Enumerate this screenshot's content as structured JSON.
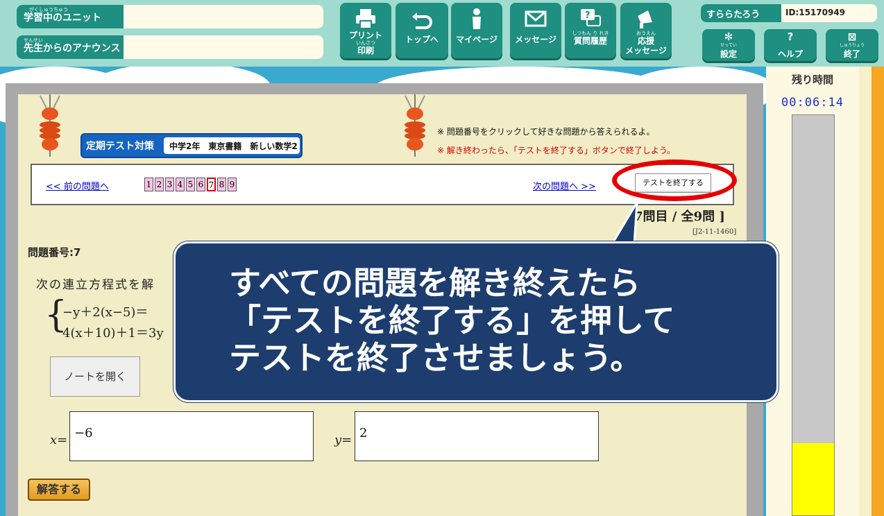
{
  "header": {
    "current_unit_label": "学習中のユニット",
    "current_unit_ruby": "がくしゅうちゅう",
    "current_unit_value": "",
    "announce_label": "先生からのアナウンス",
    "announce_ruby": "せんせい",
    "announce_value": "",
    "nav": [
      {
        "label": "プリント",
        "ruby": "いんさつ",
        "label2": "印刷",
        "icon": "printer-icon"
      },
      {
        "label": "トップへ",
        "icon": "return-arrow-icon"
      },
      {
        "label": "マイページ",
        "icon": "person-icon"
      },
      {
        "label": "メッセージ",
        "icon": "envelope-icon"
      },
      {
        "label": "質問履歴",
        "ruby": "しつもん り れき",
        "icon": "question-chat-icon"
      },
      {
        "label": "応援",
        "ruby": "おうえん",
        "label2": "メッセージ",
        "icon": "megaphone-icon"
      }
    ],
    "user_name": "すららたろう",
    "user_id": "ID:15170949",
    "settings": {
      "label": "設定",
      "ruby": "せってい",
      "icon": "gear-icon"
    },
    "help": {
      "label": "ヘルプ",
      "icon": "question-icon"
    },
    "quit": {
      "label": "終了",
      "ruby": "しゅうりょう",
      "icon": "close-icon"
    }
  },
  "timer": {
    "label": "残り時間",
    "time": "00:06:14",
    "remaining_fraction": 0.18,
    "fill_color": "#ffff00"
  },
  "test": {
    "badge_type": "定期テスト対策",
    "badge_detail": "中学2年　東京書籍　新しい数学2",
    "note1": "※ 問題番号をクリックして好きな問題から答えられるよ。",
    "note2": "※ 解き終わったら、「テストを終了する」ボタンで終了しよう。",
    "prev_label": "<< 前の問題へ",
    "next_label": "次の問題へ >>",
    "question_numbers": [
      "1",
      "2",
      "3",
      "4",
      "5",
      "6",
      "7",
      "8",
      "9"
    ],
    "current_question": "7",
    "end_button": "テストを終了する",
    "progress": "7問目 / 全9問 ]",
    "question_code": "[J2-11-1460]",
    "question_number_label": "問題番号:7",
    "question_text": "次の連立方程式を解",
    "equation1": "−y＋2(x−5)＝",
    "equation2": "4(x＋10)＋1＝3y",
    "note_button": "ノートを開く",
    "x_label": "x=",
    "x_value": "−6",
    "y_label": "y=",
    "y_value": "2",
    "submit_label": "解答する"
  },
  "callout": {
    "line1": "すべての問題を解き終えたら",
    "line2": "「テストを終了する」を押して",
    "line3": "テストを終了させましょう。"
  },
  "colors": {
    "header_bg": "#9fdccf",
    "teal": "#1e8f80",
    "callout_bg": "#1c3d6e",
    "highlight_ring": "#e60000"
  }
}
